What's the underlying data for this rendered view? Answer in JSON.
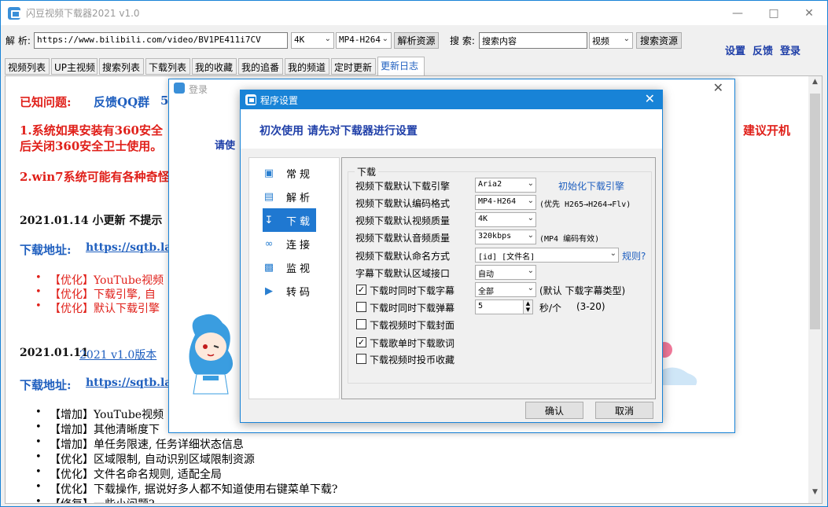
{
  "app": {
    "title": "闪豆视频下载器2021 v1.0"
  },
  "toolbar": {
    "parse_label": "解 析:",
    "url_value": "https://www.bilibili.com/video/BV1PE411i7CV",
    "quality_value": "4K",
    "format_value": "MP4-H264",
    "parse_button": "解析资源",
    "search_label": "搜 索:",
    "search_placeholder": "搜索内容",
    "search_type_value": "视频",
    "search_button": "搜索资源",
    "links": [
      "设置",
      "反馈",
      "登录"
    ]
  },
  "tabs": [
    "视频列表",
    "UP主视频",
    "搜索列表",
    "下载列表",
    "我的收藏",
    "我的追番",
    "我的频道",
    "定时更新",
    "更新日志"
  ],
  "article": {
    "known_issues": "已知问题:",
    "feedback_group": "反馈QQ群",
    "feedback_partial": "5",
    "issue1_line1": "1.系统如果安装有360安全",
    "issue1_line2": "后关闭360安全卫士使用。",
    "issue1_right": "建议开机",
    "issue2": "2.win7系统可能有各种奇怪",
    "update1_title": "2021.01.14 小更新 不提示",
    "download_label": "下载地址:",
    "download_url_partial": "https://sqtb.lanz",
    "list1": [
      "【优化】YouTube视频",
      "【优化】下载引擎, 自",
      "【优化】默认下载引擎"
    ],
    "update2_date": "2021.01.11",
    "update2_version": "2021 v1.0版本",
    "list2": [
      "【增加】YouTube视频",
      "【增加】其他清晰度下",
      "【增加】单任务限速, 任务详细状态信息",
      "【优化】区域限制, 自动识别区域限制资源",
      "【优化】文件名命名规则, 适配全局",
      "【优化】下载操作, 据说好多人都不知道使用右键菜单下载?",
      "【修复】一些小问题?"
    ]
  },
  "login_dialog": {
    "title": "登录",
    "hint": "请使"
  },
  "settings_dialog": {
    "title": "程序设置",
    "header": "初次使用 请先对下载器进行设置",
    "nav": [
      "常规",
      "解析",
      "下载",
      "连接",
      "监视",
      "转码"
    ],
    "nav_icons": [
      "general-icon",
      "parse-icon",
      "download-icon",
      "link-icon",
      "monitor-icon",
      "convert-icon"
    ],
    "group_label": "下载",
    "engine_label": "视频下载默认下载引擎",
    "engine_value": "Aria2",
    "engine_link": "初始化下载引擎",
    "codec_label": "视频下载默认编码格式",
    "codec_value": "MP4-H264",
    "codec_note": "(优先 H265→H264→Flv)",
    "vquality_label": "视频下载默认视频质量",
    "vquality_value": "4K",
    "aquality_label": "视频下载默认音频质量",
    "aquality_value": "320kbps",
    "aquality_note": "(MP4 编码有效)",
    "naming_label": "视频下载默认命名方式",
    "naming_value": "[id] [文件名]",
    "naming_link": "规则?",
    "subtitle_region_label": "字幕下载默认区域接口",
    "subtitle_region_value": "自动",
    "cb_subtitle_label": "下载时同时下载字幕",
    "cb_subtitle_checked": true,
    "subtitle_type_value": "全部",
    "subtitle_type_note": "(默认 下载字幕类型)",
    "cb_danmaku_label": "下载时同时下载弹幕",
    "cb_danmaku_checked": false,
    "danmaku_value": "5",
    "danmaku_unit": "秒/个",
    "danmaku_range": "(3-20)",
    "cb_cover_label": "下载视频时下载封面",
    "cb_cover_checked": false,
    "cb_lyrics_label": "下载歌单时下载歌词",
    "cb_lyrics_checked": true,
    "cb_coin_label": "下载视频时投币收藏",
    "cb_coin_checked": false,
    "ok_button": "确认",
    "cancel_button": "取消"
  },
  "colors": {
    "accent": "#1883d7",
    "link": "#1f3fa8",
    "red": "#e0201a"
  }
}
